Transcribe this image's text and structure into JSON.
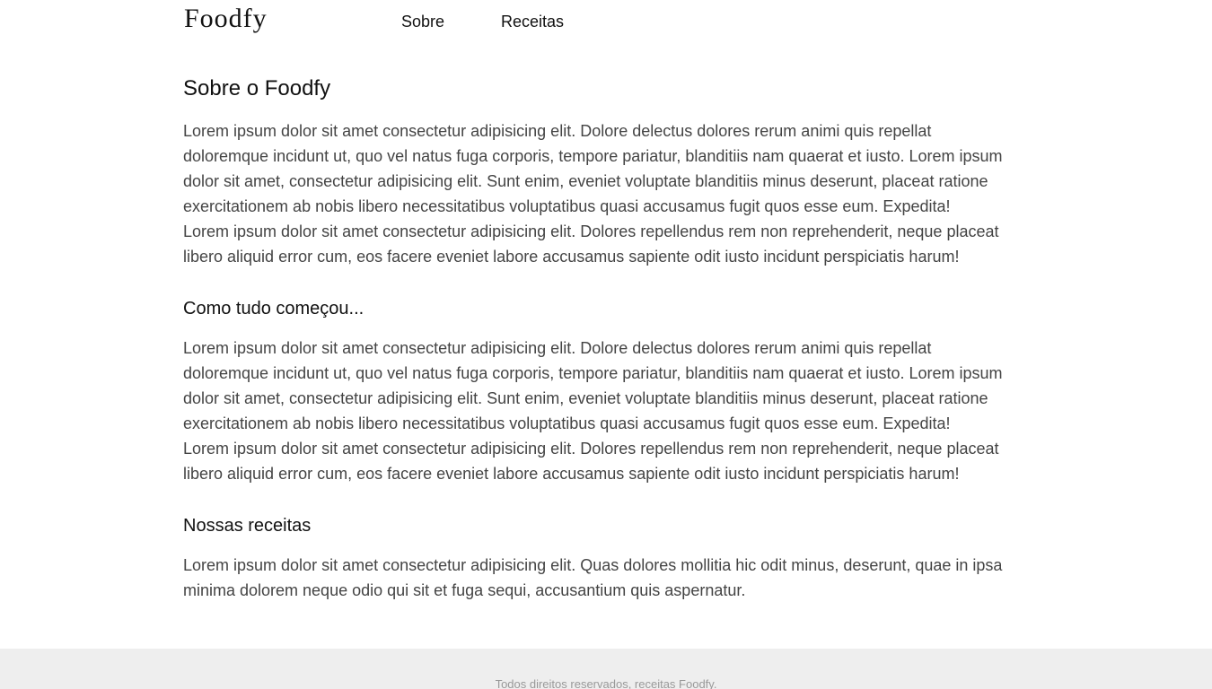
{
  "header": {
    "logo": "Foodfy",
    "nav": [
      "Sobre",
      "Receitas"
    ]
  },
  "sections": [
    {
      "title": "Sobre o Foodfy",
      "lines": [
        "Lorem ipsum dolor sit amet consectetur adipisicing elit. Dolore delectus dolores rerum animi quis repellat",
        "doloremque incidunt ut, quo vel natus fuga corporis, tempore pariatur, blanditiis nam quaerat et iusto. Lorem ipsum",
        "dolor sit amet, consectetur adipisicing elit. Sunt enim, eveniet voluptate blanditiis minus deserunt, placeat ratione",
        "exercitationem ab nobis libero necessitatibus voluptatibus quasi accusamus fugit quos esse eum. Expedita!",
        "Lorem ipsum dolor sit amet consectetur adipisicing elit. Dolores repellendus rem non reprehenderit, neque placeat",
        "libero aliquid error cum, eos facere eveniet labore accusamus sapiente odit iusto incidunt perspiciatis harum!"
      ]
    },
    {
      "title": "Como tudo começou...",
      "lines": [
        "Lorem ipsum dolor sit amet consectetur adipisicing elit. Dolore delectus dolores rerum animi quis repellat",
        "doloremque incidunt ut, quo vel natus fuga corporis, tempore pariatur, blanditiis nam quaerat et iusto. Lorem ipsum",
        "dolor sit amet, consectetur adipisicing elit. Sunt enim, eveniet voluptate blanditiis minus deserunt, placeat ratione",
        "exercitationem ab nobis libero necessitatibus voluptatibus quasi accusamus fugit quos esse eum. Expedita!",
        "Lorem ipsum dolor sit amet consectetur adipisicing elit. Dolores repellendus rem non reprehenderit, neque placeat",
        "libero aliquid error cum, eos facere eveniet labore accusamus sapiente odit iusto incidunt perspiciatis harum!"
      ]
    },
    {
      "title": "Nossas receitas",
      "lines": [
        "Lorem ipsum dolor sit amet consectetur adipisicing elit. Quas dolores mollitia hic odit minus, deserunt, quae in ipsa",
        "minima dolorem neque odio qui sit et fuga sequi, accusantium quis aspernatur."
      ]
    }
  ],
  "footer": {
    "text": "Todos direitos reservados, receitas Foodfy."
  }
}
